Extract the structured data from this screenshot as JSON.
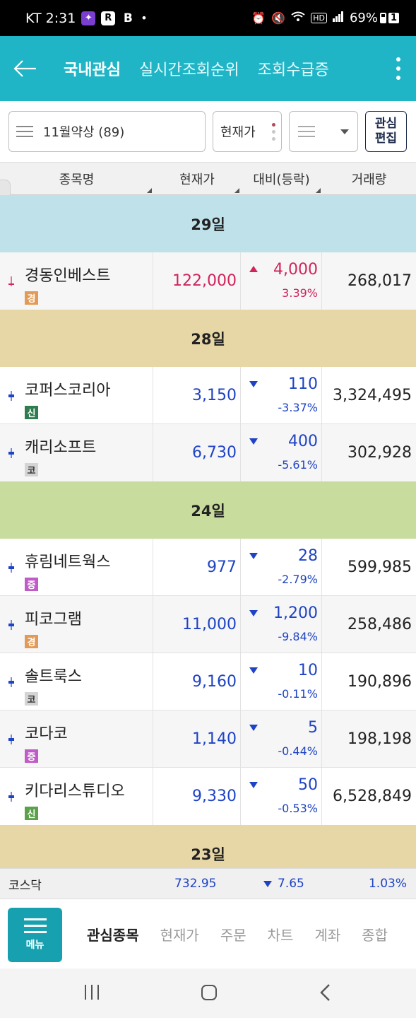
{
  "status_bar": {
    "carrier_time": "KT 2:31",
    "app_icon_r": "R",
    "app_icon_b": "B",
    "dot": "•",
    "battery_percent": "69%",
    "sim_badge": "1"
  },
  "header": {
    "tabs": [
      "국내관심",
      "실시간조회순위",
      "조회수급증"
    ],
    "active_tab_index": 0,
    "accent_color": "#1fb5c6"
  },
  "controls": {
    "group_select": "11월약상 (89)",
    "sort_select": "현재가",
    "edit_button_line1": "관심",
    "edit_button_line2": "편집"
  },
  "table": {
    "columns": [
      "종목명",
      "현재가",
      "대비(등락)",
      "거래량"
    ],
    "day_groups": [
      {
        "label": "29일",
        "color": "#bfe1ea",
        "rows": [
          {
            "name": "경동인베스트",
            "market": "경",
            "price": "122,000",
            "change": "4,000",
            "pct": "3.39%",
            "volume": "268,017",
            "direction": "up"
          }
        ]
      },
      {
        "label": "28일",
        "color": "#e7d7a6",
        "rows": [
          {
            "name": "코퍼스코리아",
            "market": "신",
            "price": "3,150",
            "change": "110",
            "pct": "-3.37%",
            "volume": "3,324,495",
            "direction": "down"
          },
          {
            "name": "캐리소프트",
            "market": "코",
            "price": "6,730",
            "change": "400",
            "pct": "-5.61%",
            "volume": "302,928",
            "direction": "down"
          }
        ]
      },
      {
        "label": "24일",
        "color": "#c8dc9e",
        "rows": [
          {
            "name": "휴림네트웍스",
            "market": "증",
            "price": "977",
            "change": "28",
            "pct": "-2.79%",
            "volume": "599,985",
            "direction": "down"
          },
          {
            "name": "피코그램",
            "market": "경",
            "price": "11,000",
            "change": "1,200",
            "pct": "-9.84%",
            "volume": "258,486",
            "direction": "down"
          },
          {
            "name": "솔트룩스",
            "market": "코",
            "price": "9,160",
            "change": "10",
            "pct": "-0.11%",
            "volume": "190,896",
            "direction": "down"
          },
          {
            "name": "코다코",
            "market": "증",
            "price": "1,140",
            "change": "5",
            "pct": "-0.44%",
            "volume": "198,198",
            "direction": "down"
          },
          {
            "name": "키다리스튜디오",
            "market": "신",
            "price": "9,330",
            "change": "50",
            "pct": "-0.53%",
            "volume": "6,528,849",
            "direction": "down"
          }
        ]
      },
      {
        "label": "23일",
        "color": "#e7d7a6",
        "rows": []
      }
    ]
  },
  "index_bar": {
    "name": "코스닥",
    "value": "732.95",
    "change": "7.65",
    "pct": "1.03%"
  },
  "bottom_nav": {
    "menu_label": "메뉴",
    "tabs": [
      "관심종목",
      "현재가",
      "주문",
      "차트",
      "계좌",
      "종합"
    ],
    "active_index": 0
  },
  "colors": {
    "up": "#d0245a",
    "down": "#1e43c4"
  }
}
